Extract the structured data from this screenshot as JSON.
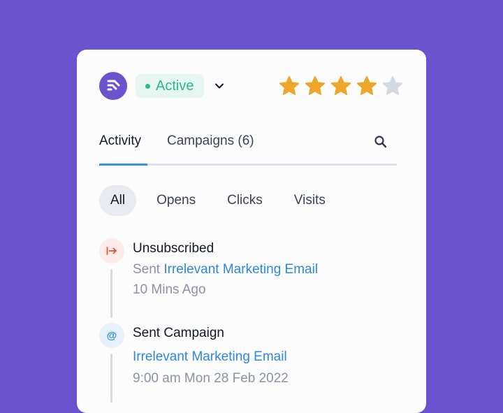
{
  "header": {
    "status_label": "Active",
    "rating": 4,
    "rating_max": 5,
    "colors": {
      "brand": "#6b52cf",
      "status": "#2cb88d",
      "star_filled": "#eea62a",
      "star_empty": "#d3d9e2",
      "accent": "#3793e0"
    }
  },
  "tabs": [
    {
      "label": "Activity",
      "active": true
    },
    {
      "label": "Campaigns (6)",
      "active": false
    }
  ],
  "filters": [
    {
      "label": "All",
      "active": true
    },
    {
      "label": "Opens",
      "active": false
    },
    {
      "label": "Clicks",
      "active": false
    },
    {
      "label": "Visits",
      "active": false
    }
  ],
  "activity": [
    {
      "icon": "unsubscribe-icon",
      "title": "Unsubscribed",
      "prefix": "Sent",
      "link": "Irrelevant Marketing Email",
      "time": "10 Mins Ago"
    },
    {
      "icon": "at-sign-icon",
      "title": "Sent Campaign",
      "prefix": "",
      "link": "Irrelevant Marketing Email",
      "time": "9:00 am Mon 28 Feb 2022"
    }
  ]
}
